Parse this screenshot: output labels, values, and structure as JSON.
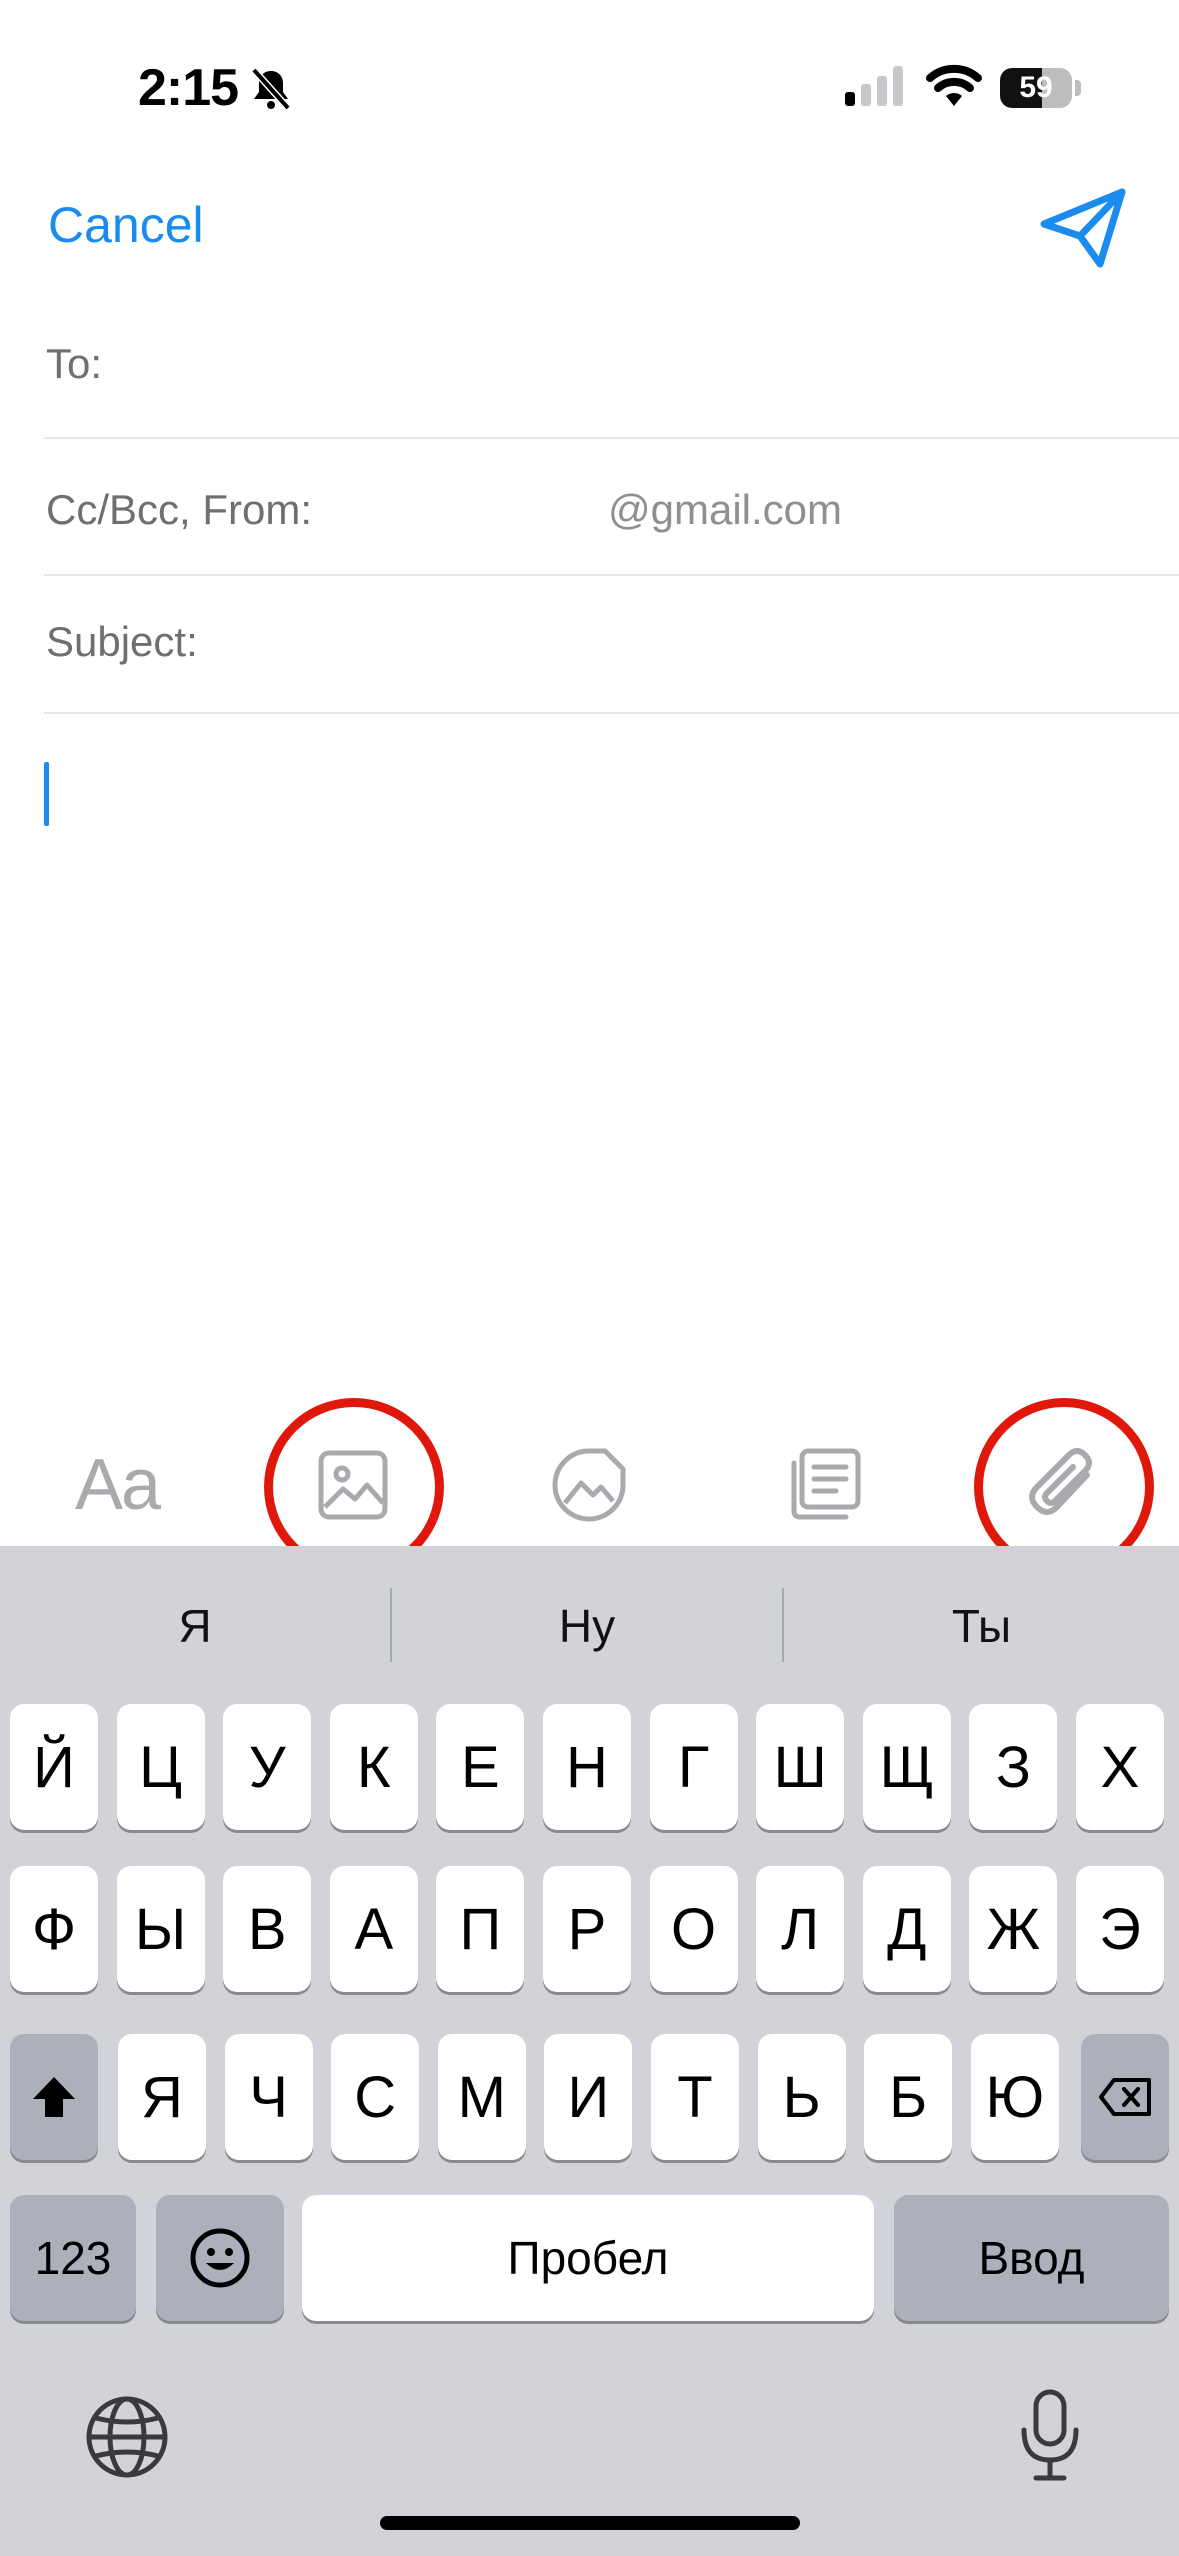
{
  "status_bar": {
    "time": "2:15",
    "battery": "59",
    "battery_level": 0.59
  },
  "nav": {
    "cancel": "Cancel"
  },
  "fields": {
    "to_label": "To:",
    "ccbcc_label": "Cc/Bcc, From:",
    "from_value": "@gmail.com",
    "subject_label": "Subject:"
  },
  "toolbar": {
    "format_label": "Aa"
  },
  "keyboard": {
    "suggestions": [
      "Я",
      "Ну",
      "Ты"
    ],
    "row1": [
      "Й",
      "Ц",
      "У",
      "К",
      "Е",
      "Н",
      "Г",
      "Ш",
      "Щ",
      "З",
      "Х"
    ],
    "row2": [
      "Ф",
      "Ы",
      "В",
      "А",
      "П",
      "Р",
      "О",
      "Л",
      "Д",
      "Ж",
      "Э"
    ],
    "row3": [
      "Я",
      "Ч",
      "С",
      "М",
      "И",
      "Т",
      "Ь",
      "Б",
      "Ю"
    ],
    "numbers_label": "123",
    "space_label": "Пробел",
    "return_label": "Ввод"
  },
  "colors": {
    "accent": "#1a8cf0",
    "highlight_ring": "#e0180c",
    "keyboard_bg": "#d1d3d9"
  }
}
